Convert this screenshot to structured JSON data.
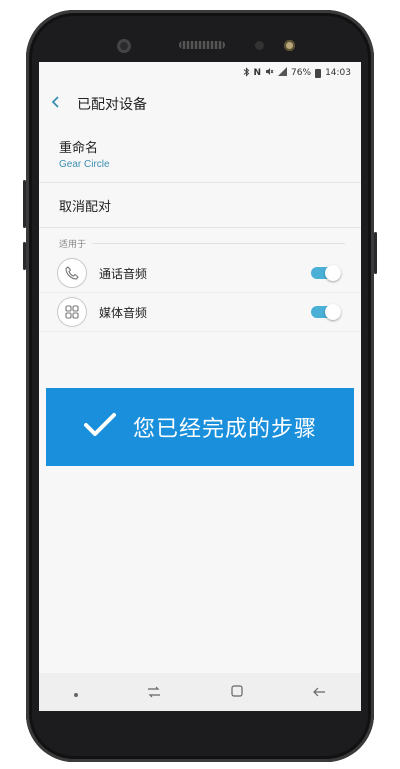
{
  "status_bar": {
    "battery": "76%",
    "time": "14:03"
  },
  "header": {
    "title": "已配对设备"
  },
  "rename": {
    "title": "重命名",
    "device_name": "Gear Circle"
  },
  "unpair": {
    "label": "取消配对"
  },
  "section": {
    "label": "适用于"
  },
  "profiles": [
    {
      "label": "通话音频",
      "icon": "phone-icon",
      "enabled": true
    },
    {
      "label": "媒体音频",
      "icon": "media-icon",
      "enabled": true
    }
  ],
  "overlay": {
    "text": "您已经完成的步骤",
    "icon": "checkmark-icon"
  },
  "colors": {
    "accent": "#3c8fb2",
    "toggle": "#4ab0d6",
    "banner": "#1a8fdc"
  }
}
